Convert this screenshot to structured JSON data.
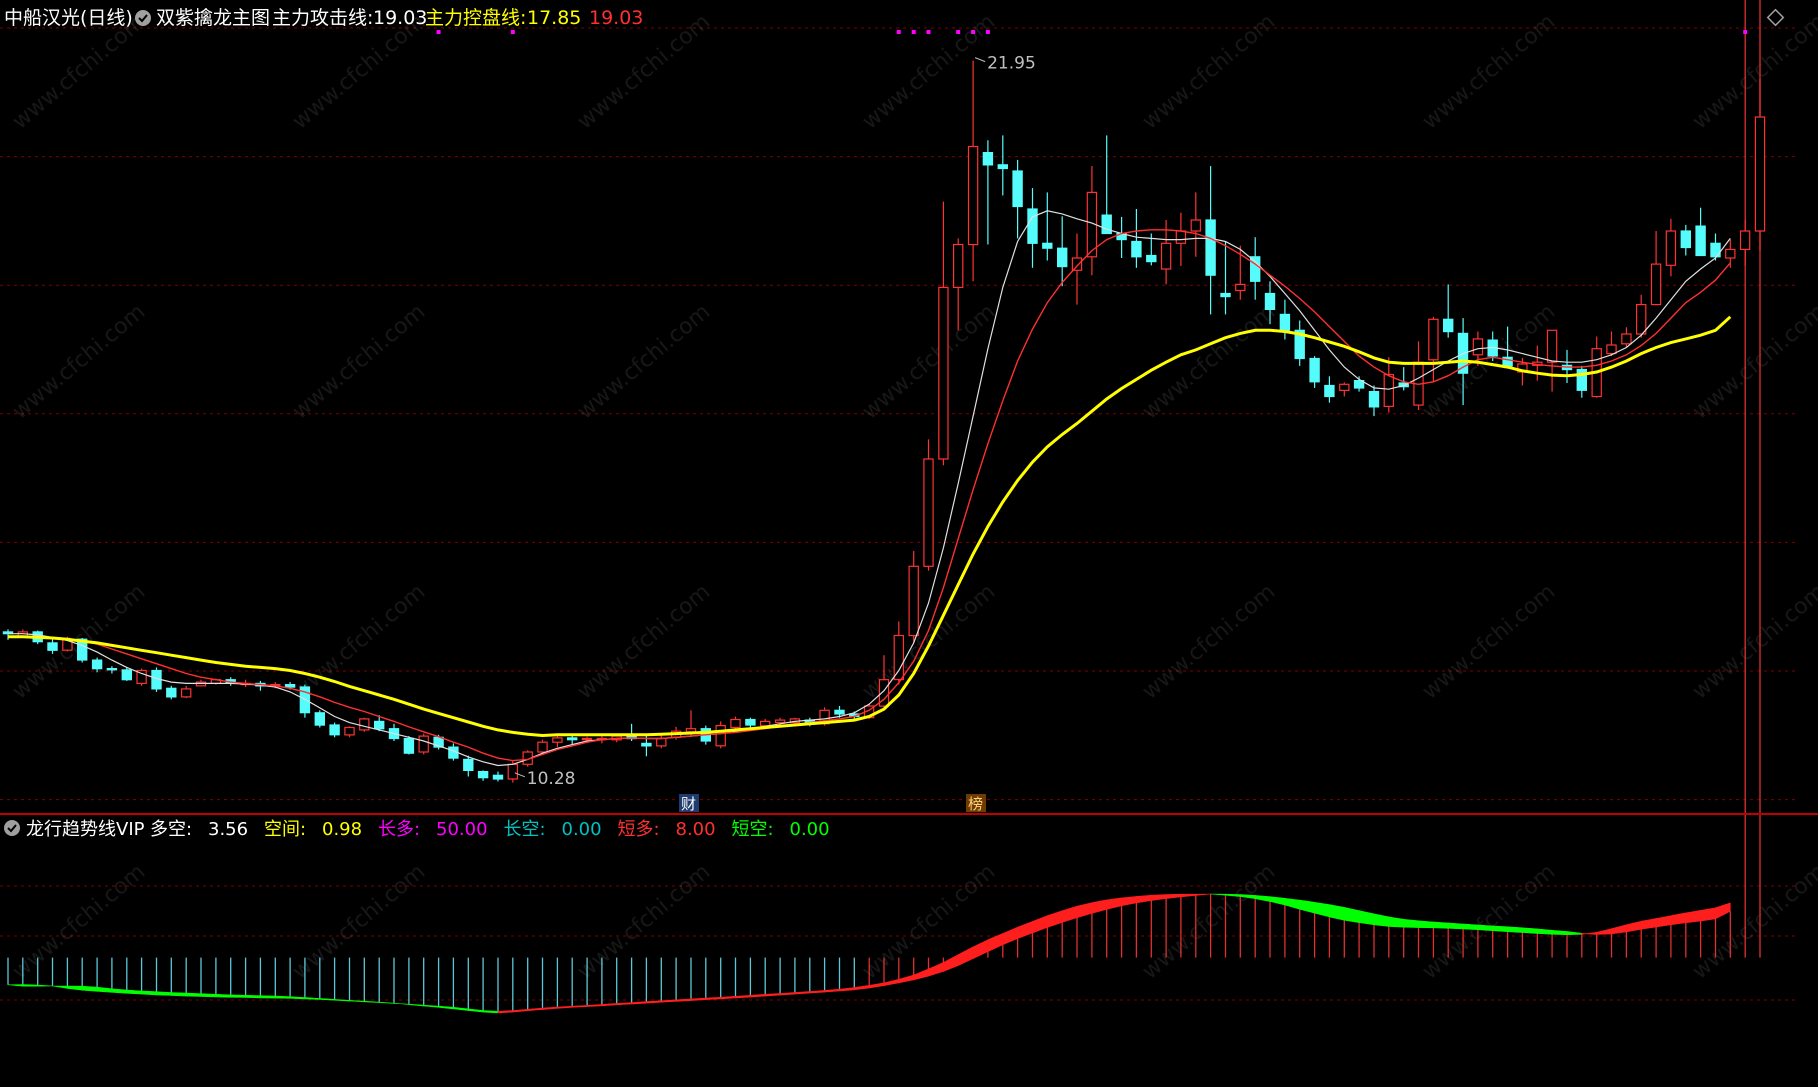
{
  "header": {
    "stock_name": "中船汉光(日线)",
    "indicator_name": "双紫擒龙主图",
    "line1_label": "主力攻击线:",
    "line1_value": "19.03",
    "line2_label": "主力控盘线:",
    "line2_value": "17.85",
    "line3_value": "19.03"
  },
  "sub_header": {
    "indicator_name": "龙行趋势线VIP",
    "items": [
      {
        "label": "多空:",
        "value": "3.56",
        "color": "#ffffff"
      },
      {
        "label": "空间:",
        "value": "0.98",
        "color": "#ffff00"
      },
      {
        "label": "长多:",
        "value": "50.00",
        "color": "#ff00ff"
      },
      {
        "label": "长空:",
        "value": "0.00",
        "color": "#00c0c0"
      },
      {
        "label": "短多:",
        "value": "8.00",
        "color": "#ff3030"
      },
      {
        "label": "短空:",
        "value": "0.00",
        "color": "#00ff00"
      }
    ]
  },
  "markers": {
    "cai": "财",
    "bang": "榜"
  },
  "colors": {
    "up": "#ff3232",
    "down": "#54fcfc",
    "ma_yellow": "#ffff00",
    "ma_red": "#ff3030",
    "ma_white": "#e0e0e0",
    "magenta": "#ff00ff",
    "grid": "#800000",
    "green": "#00ff00"
  },
  "watermark": "www.cfchi.com",
  "chart_data": {
    "type": "candlestick",
    "y_range": [
      10.0,
      22.4
    ],
    "annotations": [
      {
        "label": "21.95",
        "bar": 65,
        "value": 21.95
      },
      {
        "label": "10.28",
        "bar": 34,
        "value": 10.28
      }
    ],
    "candles": [
      [
        12.58,
        12.62,
        12.45,
        12.55
      ],
      [
        12.5,
        12.62,
        12.48,
        12.58
      ],
      [
        12.58,
        12.6,
        12.38,
        12.42
      ],
      [
        12.4,
        12.5,
        12.22,
        12.28
      ],
      [
        12.28,
        12.5,
        12.26,
        12.46
      ],
      [
        12.46,
        12.48,
        12.08,
        12.12
      ],
      [
        12.12,
        12.16,
        11.92,
        11.98
      ],
      [
        11.98,
        12.02,
        11.9,
        11.96
      ],
      [
        11.96,
        12.0,
        11.78,
        11.8
      ],
      [
        11.74,
        11.98,
        11.7,
        11.95
      ],
      [
        11.95,
        12.0,
        11.6,
        11.65
      ],
      [
        11.66,
        11.7,
        11.48,
        11.52
      ],
      [
        11.52,
        11.7,
        11.5,
        11.65
      ],
      [
        11.7,
        11.8,
        11.7,
        11.76
      ],
      [
        11.74,
        11.82,
        11.72,
        11.8
      ],
      [
        11.8,
        11.84,
        11.7,
        11.75
      ],
      [
        11.74,
        11.8,
        11.68,
        11.74
      ],
      [
        11.74,
        11.78,
        11.62,
        11.7
      ],
      [
        11.72,
        11.76,
        11.66,
        11.72
      ],
      [
        11.72,
        11.76,
        11.64,
        11.68
      ],
      [
        11.68,
        11.72,
        11.18,
        11.26
      ],
      [
        11.26,
        11.3,
        11.02,
        11.06
      ],
      [
        11.06,
        11.1,
        10.86,
        10.9
      ],
      [
        10.9,
        11.04,
        10.86,
        11.02
      ],
      [
        10.98,
        11.18,
        10.95,
        11.16
      ],
      [
        11.12,
        11.22,
        10.96,
        11.0
      ],
      [
        11.0,
        11.08,
        10.8,
        10.84
      ],
      [
        10.84,
        10.88,
        10.58,
        10.6
      ],
      [
        10.62,
        10.92,
        10.58,
        10.88
      ],
      [
        10.86,
        10.9,
        10.66,
        10.7
      ],
      [
        10.7,
        10.76,
        10.48,
        10.52
      ],
      [
        10.5,
        10.56,
        10.22,
        10.32
      ],
      [
        10.3,
        10.32,
        10.15,
        10.2
      ],
      [
        10.24,
        10.3,
        10.14,
        10.18
      ],
      [
        10.18,
        10.48,
        10.12,
        10.42
      ],
      [
        10.42,
        10.65,
        10.38,
        10.62
      ],
      [
        10.62,
        10.82,
        10.58,
        10.78
      ],
      [
        10.78,
        10.9,
        10.7,
        10.85
      ],
      [
        10.85,
        10.9,
        10.75,
        10.82
      ],
      [
        10.82,
        10.87,
        10.79,
        10.84
      ],
      [
        10.82,
        10.88,
        10.76,
        10.84
      ],
      [
        10.82,
        10.92,
        10.78,
        10.88
      ],
      [
        10.88,
        11.08,
        10.8,
        10.84
      ],
      [
        10.76,
        10.92,
        10.55,
        10.72
      ],
      [
        10.72,
        10.9,
        10.68,
        10.84
      ],
      [
        10.86,
        11.03,
        10.82,
        10.96
      ],
      [
        10.95,
        11.3,
        10.88,
        11.0
      ],
      [
        11.0,
        11.05,
        10.74,
        10.8
      ],
      [
        10.72,
        11.12,
        10.68,
        11.05
      ],
      [
        11.02,
        11.2,
        10.98,
        11.15
      ],
      [
        11.15,
        11.18,
        11.02,
        11.06
      ],
      [
        11.05,
        11.16,
        11.0,
        11.12
      ],
      [
        11.1,
        11.18,
        11.06,
        11.14
      ],
      [
        11.1,
        11.18,
        11.06,
        11.16
      ],
      [
        11.14,
        11.18,
        11.04,
        11.08
      ],
      [
        11.08,
        11.35,
        11.05,
        11.3
      ],
      [
        11.3,
        11.37,
        11.18,
        11.24
      ],
      [
        11.24,
        11.28,
        11.14,
        11.2
      ],
      [
        11.18,
        11.4,
        11.16,
        11.37
      ],
      [
        11.37,
        12.2,
        11.35,
        11.8
      ],
      [
        11.8,
        12.75,
        11.72,
        12.52
      ],
      [
        12.52,
        13.9,
        12.4,
        13.65
      ],
      [
        13.65,
        15.72,
        13.58,
        15.4
      ],
      [
        15.4,
        19.6,
        15.3,
        18.2
      ],
      [
        18.2,
        19.0,
        17.5,
        18.9
      ],
      [
        18.9,
        21.9,
        18.3,
        20.5
      ],
      [
        20.4,
        20.6,
        18.9,
        20.2
      ],
      [
        20.2,
        20.68,
        19.7,
        20.14
      ],
      [
        20.1,
        20.28,
        19.0,
        19.52
      ],
      [
        19.48,
        19.82,
        18.52,
        18.92
      ],
      [
        18.92,
        19.75,
        18.64,
        18.84
      ],
      [
        18.84,
        19.36,
        18.22,
        18.54
      ],
      [
        18.48,
        19.08,
        17.92,
        18.68
      ],
      [
        18.7,
        20.18,
        18.4,
        19.75
      ],
      [
        19.38,
        20.68,
        19.1,
        19.08
      ],
      [
        19.08,
        19.35,
        18.68,
        18.98
      ],
      [
        18.95,
        19.48,
        18.52,
        18.7
      ],
      [
        18.72,
        19.08,
        18.56,
        18.62
      ],
      [
        18.5,
        19.3,
        18.25,
        18.92
      ],
      [
        18.92,
        19.42,
        18.55,
        19.12
      ],
      [
        19.12,
        19.75,
        18.7,
        19.3
      ],
      [
        19.3,
        20.18,
        17.76,
        18.4
      ],
      [
        18.1,
        18.95,
        17.76,
        18.05
      ],
      [
        18.15,
        18.88,
        18.0,
        18.25
      ],
      [
        18.7,
        19.02,
        18.0,
        18.3
      ],
      [
        18.1,
        18.3,
        17.6,
        17.84
      ],
      [
        17.76,
        18.0,
        17.35,
        17.5
      ],
      [
        17.5,
        17.66,
        16.92,
        17.04
      ],
      [
        17.04,
        17.08,
        16.56,
        16.66
      ],
      [
        16.6,
        16.75,
        16.32,
        16.42
      ],
      [
        16.52,
        16.65,
        16.42,
        16.62
      ],
      [
        16.68,
        16.75,
        16.5,
        16.56
      ],
      [
        16.5,
        16.6,
        16.1,
        16.25
      ],
      [
        16.26,
        17.06,
        16.16,
        16.78
      ],
      [
        16.64,
        16.9,
        16.52,
        16.58
      ],
      [
        16.28,
        17.32,
        16.2,
        16.98
      ],
      [
        17.02,
        17.72,
        16.65,
        17.68
      ],
      [
        17.68,
        18.25,
        17.38,
        17.48
      ],
      [
        17.45,
        17.7,
        16.28,
        16.8
      ],
      [
        17.1,
        17.48,
        16.92,
        17.36
      ],
      [
        17.34,
        17.48,
        17.0,
        17.08
      ],
      [
        17.06,
        17.56,
        16.96,
        16.92
      ],
      [
        16.82,
        17.05,
        16.6,
        16.95
      ],
      [
        16.93,
        17.25,
        16.68,
        16.98
      ],
      [
        16.98,
        17.4,
        16.5,
        17.5
      ],
      [
        16.93,
        17.18,
        16.64,
        16.86
      ],
      [
        16.86,
        16.92,
        16.4,
        16.52
      ],
      [
        16.42,
        17.4,
        16.4,
        17.2
      ],
      [
        17.12,
        17.48,
        17.08,
        17.26
      ],
      [
        17.28,
        17.55,
        17.22,
        17.44
      ],
      [
        17.44,
        18.08,
        17.38,
        17.92
      ],
      [
        17.92,
        19.12,
        17.92,
        18.58
      ],
      [
        18.56,
        19.32,
        18.38,
        19.12
      ],
      [
        19.12,
        19.22,
        18.72,
        18.85
      ],
      [
        19.2,
        19.5,
        18.96,
        18.72
      ],
      [
        18.92,
        19.08,
        18.64,
        18.7
      ],
      [
        18.68,
        18.98,
        18.52,
        18.82
      ],
      [
        18.82,
        19.3,
        18.55,
        19.12
      ],
      [
        19.12,
        21.6,
        18.8,
        20.98
      ]
    ],
    "ma_yellow": [
      12.5,
      12.5,
      12.49,
      12.48,
      12.46,
      12.43,
      12.4,
      12.36,
      12.32,
      12.28,
      12.24,
      12.2,
      12.16,
      12.12,
      12.08,
      12.05,
      12.02,
      12.0,
      11.98,
      11.95,
      11.9,
      11.84,
      11.77,
      11.69,
      11.62,
      11.55,
      11.48,
      11.4,
      11.32,
      11.25,
      11.18,
      11.11,
      11.04,
      10.98,
      10.94,
      10.91,
      10.89,
      10.9,
      10.9,
      10.9,
      10.9,
      10.9,
      10.9,
      10.9,
      10.91,
      10.92,
      10.93,
      10.94,
      10.96,
      10.98,
      11.0,
      11.02,
      11.04,
      11.06,
      11.08,
      11.1,
      11.12,
      11.14,
      11.2,
      11.32,
      11.55,
      11.9,
      12.35,
      12.85,
      13.35,
      13.85,
      14.3,
      14.7,
      15.05,
      15.35,
      15.6,
      15.8,
      15.98,
      16.18,
      16.38,
      16.55,
      16.7,
      16.85,
      16.98,
      17.1,
      17.18,
      17.28,
      17.38,
      17.45,
      17.5,
      17.5,
      17.48,
      17.44,
      17.38,
      17.31,
      17.24,
      17.15,
      17.05,
      16.98,
      16.96,
      16.96,
      16.96,
      16.98,
      17.0,
      16.98,
      16.94,
      16.9,
      16.84,
      16.8,
      16.77,
      16.76,
      16.78,
      16.82,
      16.9,
      17.0,
      17.12,
      17.22,
      17.3,
      17.36,
      17.42,
      17.5,
      17.72
    ],
    "ma_red": [
      12.5,
      12.5,
      12.49,
      12.48,
      12.46,
      12.43,
      12.38,
      12.3,
      12.22,
      12.14,
      12.06,
      11.98,
      11.9,
      11.84,
      11.8,
      11.76,
      11.74,
      11.72,
      11.7,
      11.66,
      11.6,
      11.52,
      11.43,
      11.35,
      11.28,
      11.2,
      11.12,
      11.03,
      10.95,
      10.87,
      10.78,
      10.7,
      10.6,
      10.52,
      10.48,
      10.5,
      10.58,
      10.66,
      10.72,
      10.78,
      10.82,
      10.84,
      10.85,
      10.84,
      10.84,
      10.86,
      10.88,
      10.9,
      10.92,
      10.94,
      10.97,
      11.0,
      11.04,
      11.06,
      11.1,
      11.13,
      11.16,
      11.2,
      11.3,
      11.48,
      11.75,
      12.1,
      12.6,
      13.3,
      14.1,
      14.9,
      15.65,
      16.35,
      17.0,
      17.52,
      17.95,
      18.28,
      18.55,
      18.8,
      18.98,
      19.08,
      19.12,
      19.14,
      19.14,
      19.12,
      19.08,
      19.0,
      18.88,
      18.74,
      18.58,
      18.4,
      18.22,
      18.02,
      17.8,
      17.56,
      17.32,
      17.08,
      16.9,
      16.76,
      16.66,
      16.62,
      16.66,
      16.76,
      16.9,
      17.02,
      17.06,
      17.02,
      16.98,
      16.94,
      16.92,
      16.9,
      16.9,
      16.93,
      17.0,
      17.1,
      17.25,
      17.45,
      17.7,
      17.95,
      18.12,
      18.32,
      18.6
    ],
    "ma_white": [
      12.55,
      12.55,
      12.53,
      12.49,
      12.44,
      12.36,
      12.25,
      12.12,
      12.0,
      11.9,
      11.82,
      11.76,
      11.74,
      11.74,
      11.74,
      11.74,
      11.73,
      11.71,
      11.68,
      11.6,
      11.48,
      11.34,
      11.2,
      11.1,
      11.04,
      10.98,
      10.92,
      10.86,
      10.8,
      10.72,
      10.64,
      10.54,
      10.46,
      10.4,
      10.42,
      10.5,
      10.6,
      10.68,
      10.74,
      10.8,
      10.82,
      10.84,
      10.85,
      10.84,
      10.84,
      10.86,
      10.88,
      10.9,
      10.92,
      10.95,
      11.0,
      11.04,
      11.08,
      11.12,
      11.14,
      11.16,
      11.2,
      11.26,
      11.4,
      11.62,
      11.95,
      12.4,
      13.05,
      13.95,
      15.0,
      16.1,
      17.2,
      18.2,
      18.95,
      19.35,
      19.45,
      19.4,
      19.32,
      19.25,
      19.15,
      19.08,
      19.02,
      19.0,
      18.98,
      18.98,
      19.0,
      19.0,
      18.95,
      18.82,
      18.62,
      18.38,
      18.1,
      17.82,
      17.5,
      17.18,
      16.9,
      16.7,
      16.56,
      16.54,
      16.6,
      16.72,
      16.86,
      17.0,
      17.12,
      17.2,
      17.22,
      17.18,
      17.12,
      17.06,
      17.0,
      16.98,
      16.98,
      17.02,
      17.1,
      17.22,
      17.42,
      17.7,
      18.0,
      18.3,
      18.5,
      18.68,
      19.0
    ],
    "sub_indicator": {
      "band_upper": [
        49.2,
        49.3,
        49.1,
        48.6,
        47.4,
        46.5,
        45.9,
        45.4,
        44.9,
        44.5,
        44.1,
        43.8,
        43.5,
        43.3,
        43.1,
        42.9,
        42.8,
        42.6,
        42.5,
        42.4,
        42.1,
        41.8,
        41.4,
        41.0,
        40.6,
        40.2,
        39.8,
        39.4,
        38.9,
        38.4,
        37.8,
        37.0,
        36.2,
        35.8,
        36.2,
        36.8,
        37.4,
        37.9,
        38.4,
        38.8,
        39.3,
        39.8,
        40.2,
        40.7,
        41.1,
        41.6,
        42.1,
        42.5,
        42.9,
        43.4,
        43.9,
        44.4,
        44.8,
        45.3,
        45.8,
        46.4,
        47.0,
        47.8,
        48.9,
        50.2,
        52.0,
        54.2,
        57.2,
        60.5,
        64.5,
        68.4,
        72.0,
        75.2,
        78.4,
        81.3,
        84.2,
        86.7,
        89.0,
        90.8,
        92.2,
        93.2,
        94.0,
        94.6,
        94.9,
        95.1,
        95.1,
        95.2,
        94.6,
        93.9,
        92.8,
        91.4,
        89.6,
        87.5,
        85.5,
        83.6,
        81.9,
        80.7,
        79.6,
        78.8,
        78.4,
        78.2,
        78.1,
        77.8,
        77.5,
        77.1,
        76.6,
        76.1,
        75.7,
        75.2,
        74.8,
        74.6,
        74.8,
        75.8,
        77.6,
        79.6,
        81.4,
        82.8,
        84.2,
        85.6,
        86.9,
        88.2,
        90.7
      ],
      "band_lower": [
        49.2,
        48.5,
        48.5,
        48.6,
        48.6,
        48.5,
        48.0,
        47.2,
        46.6,
        46.1,
        45.7,
        45.3,
        45.0,
        44.7,
        44.4,
        44.1,
        43.9,
        43.7,
        43.5,
        43.2,
        42.8,
        42.3,
        41.8,
        41.3,
        40.9,
        40.4,
        39.9,
        39.2,
        38.5,
        37.8,
        37.0,
        36.2,
        35.4,
        35.0,
        35.4,
        36.1,
        36.7,
        37.3,
        37.8,
        38.2,
        38.6,
        39.1,
        39.5,
        39.9,
        40.4,
        40.8,
        41.2,
        41.7,
        42.1,
        42.6,
        43.0,
        43.5,
        44.0,
        44.5,
        45.0,
        45.5,
        46.1,
        46.7,
        47.6,
        48.8,
        50.2,
        51.7,
        53.6,
        56.0,
        59.0,
        62.5,
        66.0,
        69.5,
        72.6,
        75.5,
        78.3,
        80.8,
        83.2,
        85.4,
        87.4,
        89.2,
        90.7,
        91.9,
        92.9,
        93.7,
        94.5,
        95.2,
        95.1,
        94.9,
        94.5,
        93.8,
        93.0,
        92.1,
        91.0,
        89.8,
        88.4,
        86.8,
        85.1,
        83.6,
        82.4,
        81.6,
        81.0,
        80.5,
        80.0,
        79.5,
        79.0,
        78.6,
        78.1,
        77.5,
        76.8,
        76.2,
        75.3,
        74.7,
        75.0,
        76.0,
        77.3,
        78.5,
        79.6,
        80.6,
        81.5,
        82.6,
        86.5
      ],
      "histogram_level": 63.0,
      "histogram_range": [
        0,
        120
      ]
    }
  }
}
